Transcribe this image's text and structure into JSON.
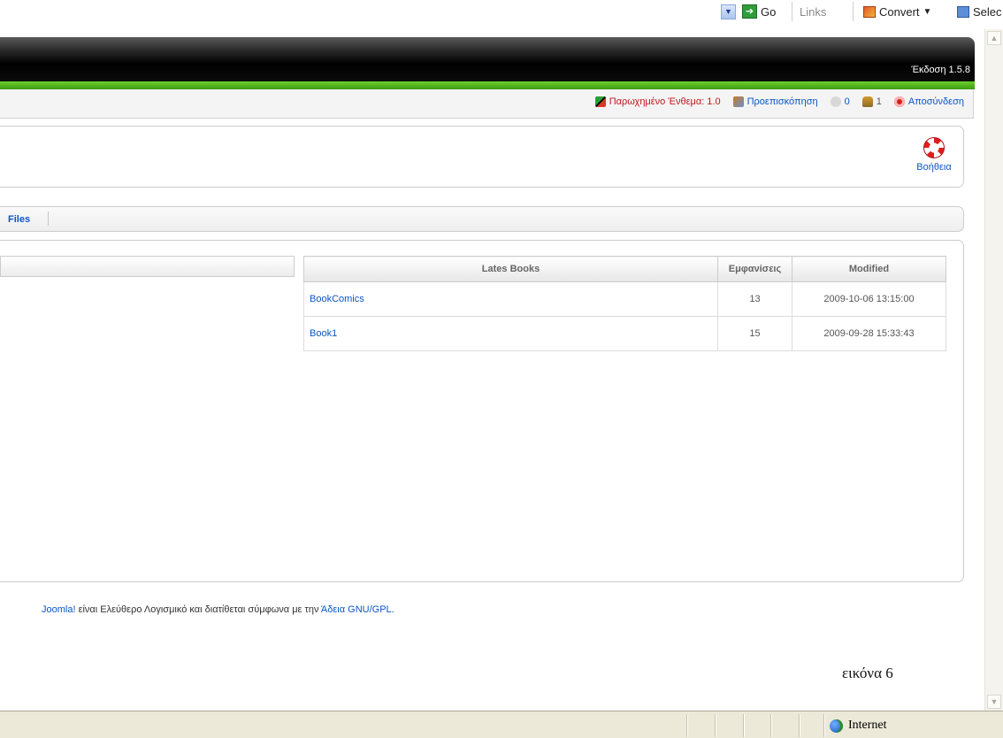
{
  "browser_toolbar": {
    "go_label": "Go",
    "links_label": "Links",
    "convert_label": "Convert",
    "select_label": "Selec"
  },
  "header": {
    "version": "Έκδοση 1.5.8"
  },
  "status_bar": {
    "legacy": "Παρωχημένο Ένθεμα: 1.0",
    "preview": "Προεπισκόπηση",
    "messages": "0",
    "users": "1",
    "logout": "Αποσύνδεση"
  },
  "toolbar": {
    "help_label": "Βοήθεια"
  },
  "submenu": {
    "files_label": "Files"
  },
  "books_table": {
    "headers": [
      "Lates Books",
      "Εμφανίσεις",
      "Modified"
    ],
    "rows": [
      {
        "title": "BookComics",
        "hits": "13",
        "modified": "2009-10-06 13:15:00"
      },
      {
        "title": "Book1",
        "hits": "15",
        "modified": "2009-09-28 15:33:43"
      }
    ]
  },
  "footer": {
    "joomla_link": "Joomla!",
    "text": " είναι Ελεύθερο Λογισμικό και διατίθεται σύμφωνα με την ",
    "license_link": "Άδεια GNU/GPL",
    "end": "."
  },
  "caption": "εικόνα 6",
  "ie_status": {
    "zone": "Internet"
  },
  "colors": {
    "link": "#0B55C4",
    "green_bar": "#4fb01c",
    "header_dark": "#000000",
    "legacy_red": "#c0161b"
  },
  "icons": [
    "dropdown-arrow-icon",
    "go-arrow-icon",
    "convert-icon",
    "select-icon",
    "legacy-module-icon",
    "preview-icon",
    "messages-icon",
    "users-icon",
    "logout-icon",
    "lifebuoy-help-icon",
    "globe-icon",
    "scroll-up-icon",
    "scroll-down-icon"
  ]
}
